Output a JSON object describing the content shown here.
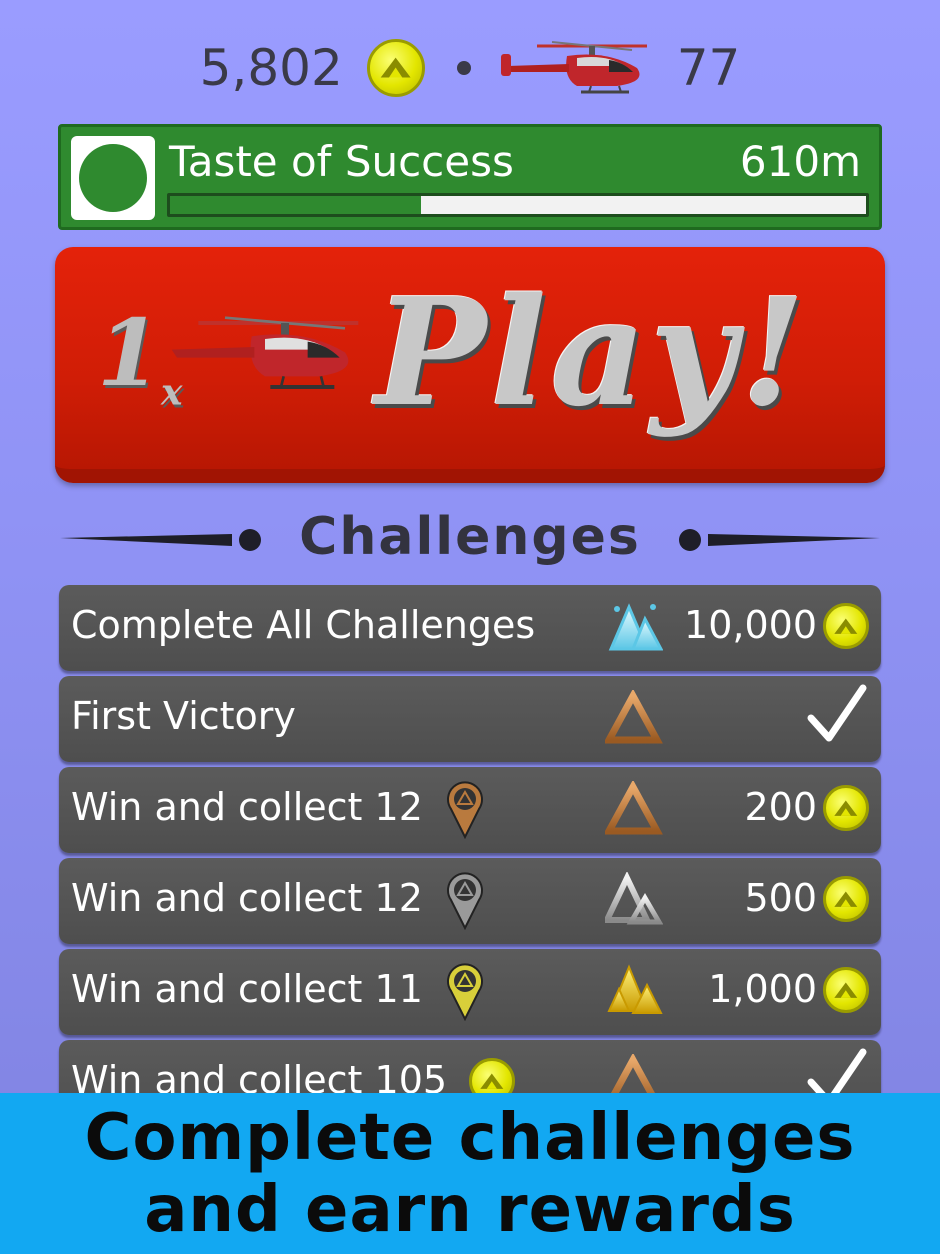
{
  "status": {
    "coins": "5,802",
    "helicopters": "77",
    "coin_icon": "mountain-coin-icon",
    "heli_icon": "helicopter-icon"
  },
  "goal": {
    "title": "Taste of Success",
    "distance": "610m",
    "progress": 0.36,
    "color": "#2f8a2f"
  },
  "play": {
    "multiplier": "1",
    "multiplier_suffix": "x",
    "label": "Play!"
  },
  "challenges": {
    "title": "Challenges",
    "items": [
      {
        "label": "Complete All Challenges",
        "tier": "diamond",
        "reward": "10,000",
        "done": false,
        "pin": null
      },
      {
        "label": "First Victory",
        "tier": "bronze",
        "reward": "",
        "done": true,
        "pin": null
      },
      {
        "label": "Win and collect 12",
        "tier": "bronze",
        "reward": "200",
        "done": false,
        "pin": "bronze"
      },
      {
        "label": "Win and collect 12",
        "tier": "silver",
        "reward": "500",
        "done": false,
        "pin": "silver"
      },
      {
        "label": "Win and collect 11",
        "tier": "gold",
        "reward": "1,000",
        "done": false,
        "pin": "gold"
      },
      {
        "label": "Win and collect 105",
        "tier": "bronze",
        "reward": "",
        "done": true,
        "pin": "coin"
      }
    ]
  },
  "banner": {
    "line1": "Complete challenges",
    "line2": "and earn rewards"
  }
}
